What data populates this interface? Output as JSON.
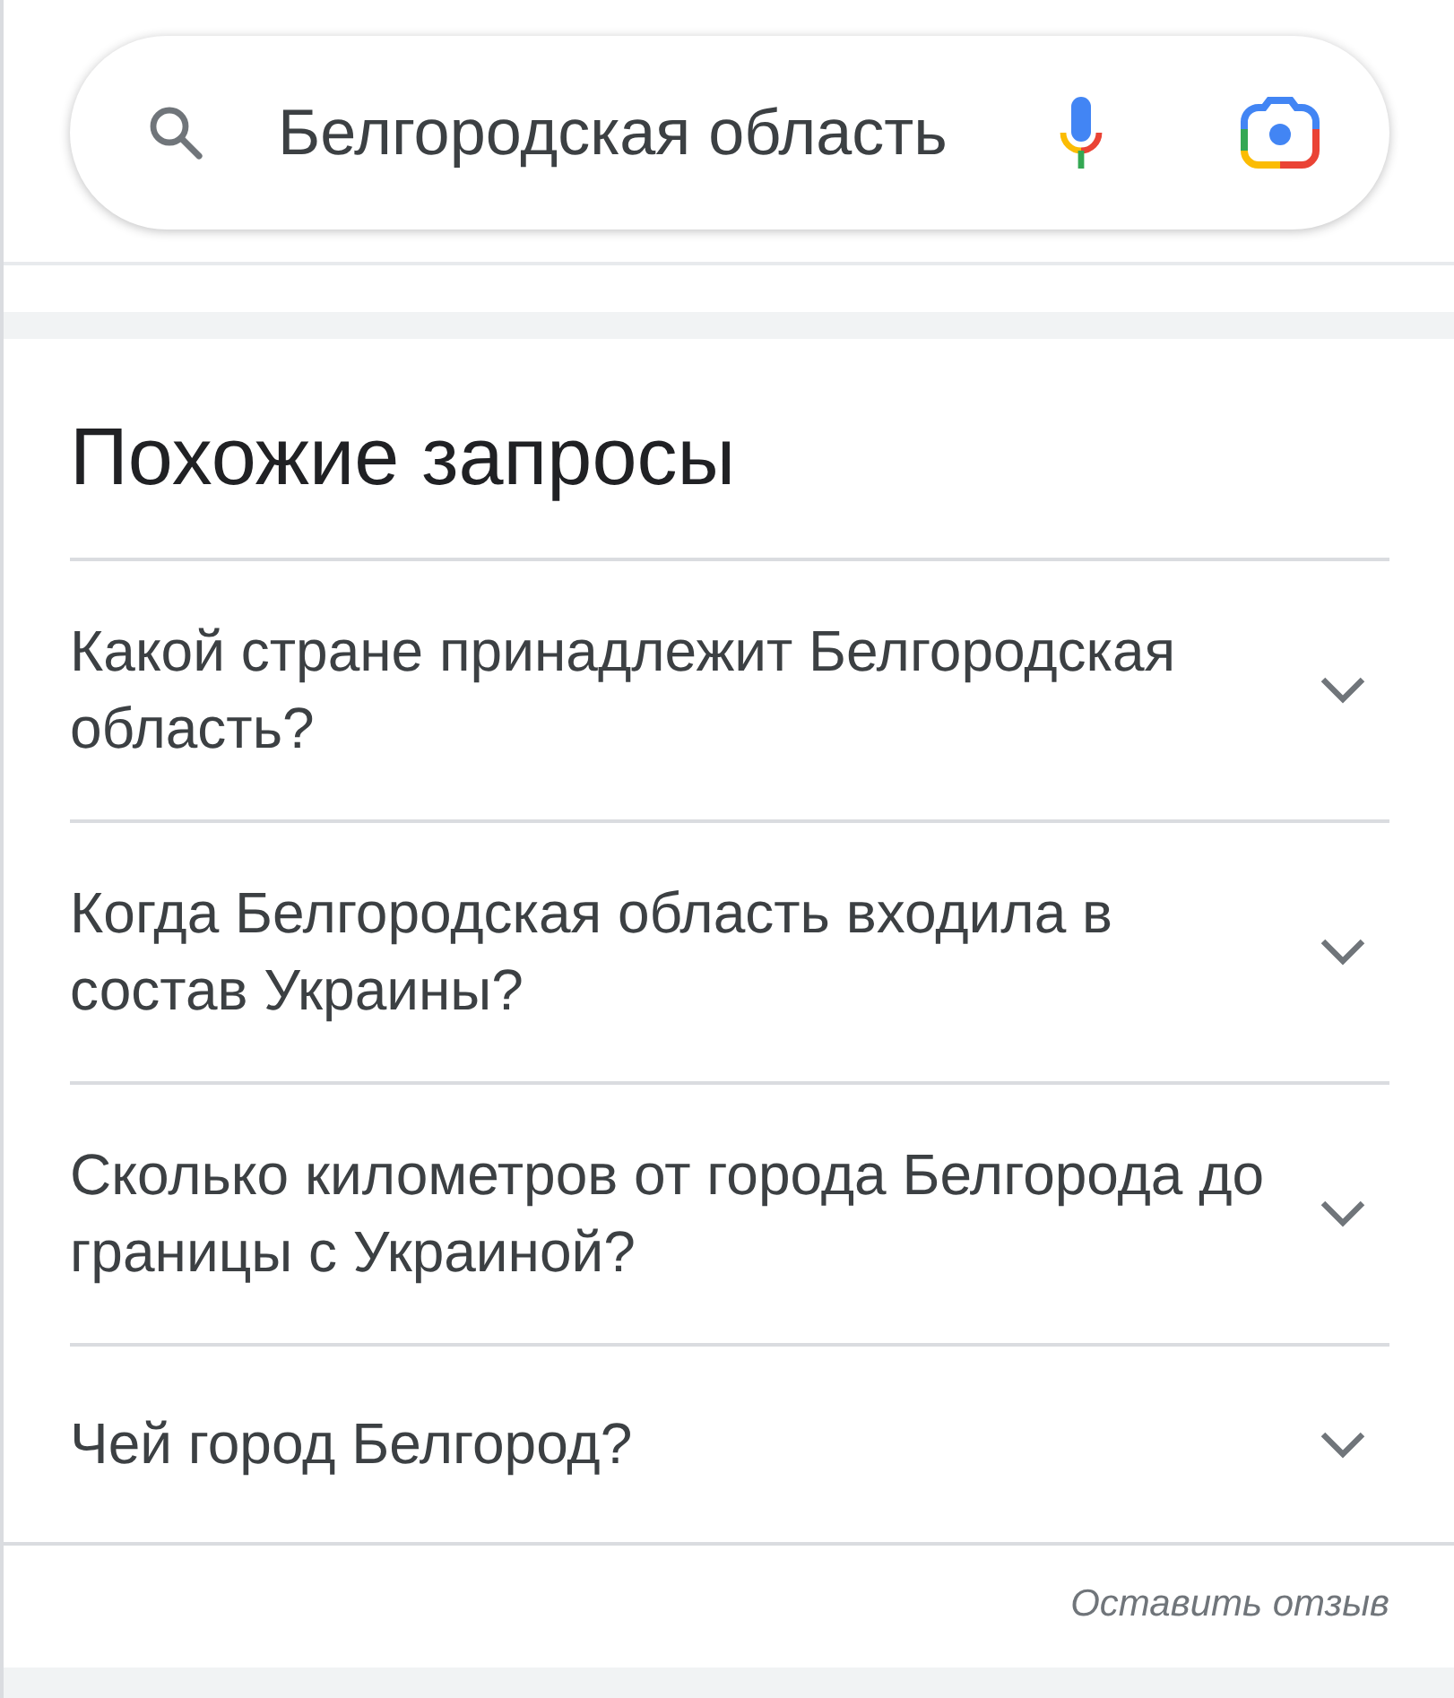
{
  "search": {
    "value": "Белгородская область"
  },
  "related": {
    "title": "Похожие запросы",
    "items": [
      {
        "text": "Какой стране принадлежит Белгородская область?",
        "expanded": false
      },
      {
        "text": "Когда Белгородская область входила в состав Украины?",
        "expanded": false
      },
      {
        "text": "Сколько километров от города Белгорода до границы с Украиной?",
        "expanded": false
      },
      {
        "text": "Чей город Белгород?",
        "expanded": false
      }
    ]
  },
  "feedback": {
    "label": "Оставить отзыв"
  }
}
